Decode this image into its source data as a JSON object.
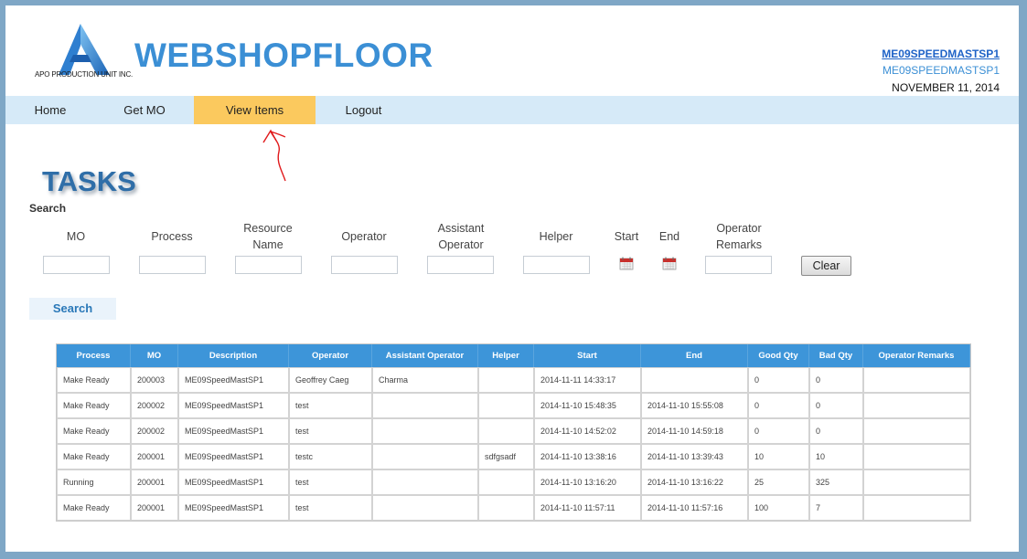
{
  "header": {
    "logo_text": "APO PRODUCTION UNIT INC.",
    "brand": "WEBSHOPFLOOR",
    "user_link": "ME09SPEEDMASTSP1",
    "user_sub": "ME09SPEEDMASTSP1",
    "date": "NOVEMBER 11, 2014",
    "brand_color": "#3b8fd5"
  },
  "nav": {
    "items": [
      {
        "label": "Home",
        "active": false
      },
      {
        "label": "Get MO",
        "active": false
      },
      {
        "label": "View Items",
        "active": true
      },
      {
        "label": "Logout",
        "active": false
      }
    ],
    "active_color": "#fbc95e"
  },
  "page": {
    "title": "TASKS",
    "search_label": "Search"
  },
  "filters": {
    "mo": "MO",
    "process": "Process",
    "resource_name": "Resource Name",
    "operator": "Operator",
    "assistant_operator": "Assistant Operator",
    "helper": "Helper",
    "start": "Start",
    "end": "End",
    "operator_remarks": "Operator Remarks",
    "clear_label": "Clear",
    "search_label": "Search"
  },
  "table": {
    "headers": [
      "Process",
      "MO",
      "Description",
      "Operator",
      "Assistant Operator",
      "Helper",
      "Start",
      "End",
      "Good Qty",
      "Bad Qty",
      "Operator Remarks"
    ],
    "rows": [
      [
        "Make Ready",
        "200003",
        "ME09SpeedMastSP1",
        "Geoffrey Caeg",
        "Charma",
        "",
        "2014-11-11 14:33:17",
        "",
        "0",
        "0",
        ""
      ],
      [
        "Make Ready",
        "200002",
        "ME09SpeedMastSP1",
        "test",
        "",
        "",
        "2014-11-10 15:48:35",
        "2014-11-10 15:55:08",
        "0",
        "0",
        ""
      ],
      [
        "Make Ready",
        "200002",
        "ME09SpeedMastSP1",
        "test",
        "",
        "",
        "2014-11-10 14:52:02",
        "2014-11-10 14:59:18",
        "0",
        "0",
        ""
      ],
      [
        "Make Ready",
        "200001",
        "ME09SpeedMastSP1",
        "testc",
        "",
        "sdfgsadf",
        "2014-11-10 13:38:16",
        "2014-11-10 13:39:43",
        "10",
        "10",
        ""
      ],
      [
        "Running",
        "200001",
        "ME09SpeedMastSP1",
        "test",
        "",
        "",
        "2014-11-10 13:16:20",
        "2014-11-10 13:16:22",
        "25",
        "325",
        ""
      ],
      [
        "Make Ready",
        "200001",
        "ME09SpeedMastSP1",
        "test",
        "",
        "",
        "2014-11-10 11:57:11",
        "2014-11-10 11:57:16",
        "100",
        "7",
        ""
      ]
    ],
    "header_color": "#3d95d9"
  },
  "icons": {
    "logo": "triangle-a-logo-icon",
    "calendar": "calendar-icon",
    "annotation": "red-arrow-annotation-icon"
  }
}
